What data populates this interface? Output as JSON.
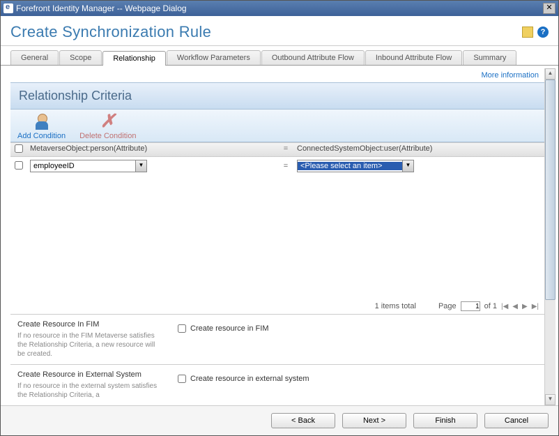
{
  "window": {
    "title": "Forefront Identity Manager -- Webpage Dialog"
  },
  "header": {
    "title": "Create Synchronization Rule"
  },
  "tabs": [
    {
      "label": "General",
      "active": false
    },
    {
      "label": "Scope",
      "active": false
    },
    {
      "label": "Relationship",
      "active": true
    },
    {
      "label": "Workflow Parameters",
      "active": false
    },
    {
      "label": "Outbound Attribute Flow",
      "active": false
    },
    {
      "label": "Inbound Attribute Flow",
      "active": false
    },
    {
      "label": "Summary",
      "active": false
    }
  ],
  "more_info": "More information",
  "section": {
    "title": "Relationship Criteria"
  },
  "toolbar": {
    "add": "Add Condition",
    "delete": "Delete Condition"
  },
  "grid": {
    "left_header": "MetaverseObject:person(Attribute)",
    "right_header": "ConnectedSystemObject:user(Attribute)",
    "eq": "=",
    "rows": [
      {
        "left_value": "employeeID",
        "right_value": "<Please select an item>"
      }
    ]
  },
  "pager": {
    "total_label": "1 items total",
    "page_label": "Page",
    "page_value": "1",
    "of_label": "of 1"
  },
  "panels": {
    "fim": {
      "title": "Create Resource In FIM",
      "sub": "If no resource in the FIM Metaverse satisfies the Relationship Criteria, a new resource will be created.",
      "checkbox_label": "Create resource in FIM"
    },
    "ext": {
      "title": "Create Resource in External System",
      "sub": "If no resource in the external system satisfies the Relationship Criteria, a",
      "checkbox_label": "Create resource in external system"
    }
  },
  "footer": {
    "back": "< Back",
    "next": "Next >",
    "finish": "Finish",
    "cancel": "Cancel"
  }
}
